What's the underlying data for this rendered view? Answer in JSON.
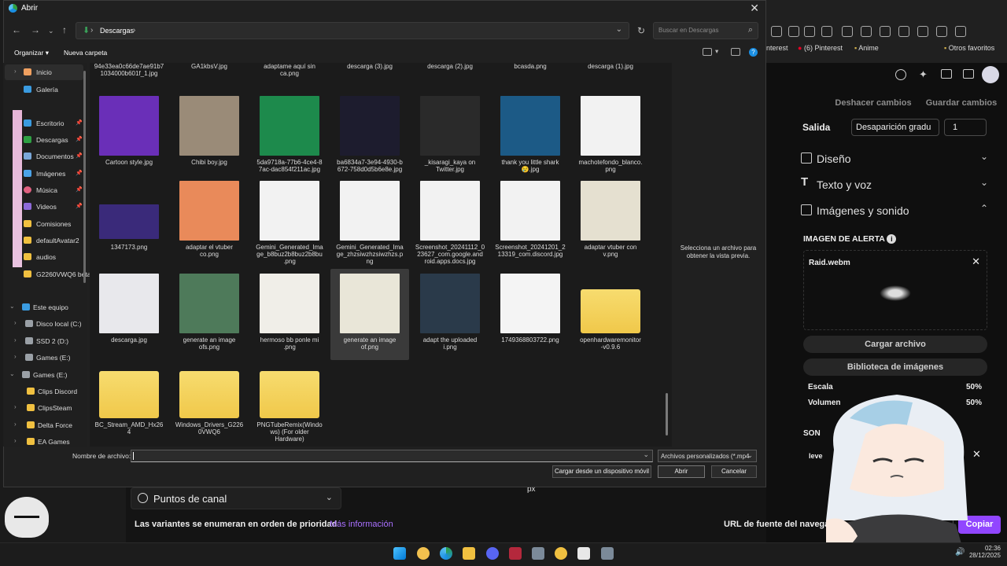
{
  "dialog": {
    "title": "Abrir",
    "breadcrumb": "Descargas",
    "search_placeholder": "Buscar en Descargas",
    "toolbar": {
      "organize": "Organizar",
      "new_folder": "Nueva carpeta"
    },
    "sidebar": {
      "items": [
        {
          "label": "Inicio"
        },
        {
          "label": "Galería"
        },
        {
          "label": "Escritorio"
        },
        {
          "label": "Descargas"
        },
        {
          "label": "Documentos"
        },
        {
          "label": "Imágenes"
        },
        {
          "label": "Música"
        },
        {
          "label": "Videos"
        },
        {
          "label": "Comisiones"
        },
        {
          "label": "defaultAvatar2"
        },
        {
          "label": "audios"
        },
        {
          "label": "G2260VWQ6 beta"
        },
        {
          "label": "Este equipo"
        },
        {
          "label": "Disco local (C:)"
        },
        {
          "label": "SSD 2 (D:)"
        },
        {
          "label": "Games  (E:)"
        },
        {
          "label": "Games  (E:)"
        },
        {
          "label": "Clips Discord"
        },
        {
          "label": "ClipsSteam"
        },
        {
          "label": "Delta Force"
        },
        {
          "label": "EA Games"
        }
      ]
    },
    "files": [
      {
        "l1": "94e33ea0c66de7ae91b7",
        "l2": "1034000b601f_1.jpg",
        "l3": ""
      },
      {
        "l1": "GA1kbsV.jpg",
        "l2": "",
        "l3": ""
      },
      {
        "l1": "adaptame aquí sin",
        "l2": "ca.png",
        "l3": ""
      },
      {
        "l1": "descarga (3).jpg",
        "l2": "",
        "l3": ""
      },
      {
        "l1": "descarga (2).jpg",
        "l2": "",
        "l3": ""
      },
      {
        "l1": "bcasda.png",
        "l2": "",
        "l3": ""
      },
      {
        "l1": "descarga (1).jpg",
        "l2": "",
        "l3": ""
      },
      {
        "l1": "Cartoon style.jpg",
        "l2": "",
        "l3": ""
      },
      {
        "l1": "Chibi boy.jpg",
        "l2": "",
        "l3": ""
      },
      {
        "l1": "5da9718a-77b6-4ce4-8",
        "l2": "7ac-dac854f211ac.jpg",
        "l3": ""
      },
      {
        "l1": "ba6834a7-3e94-4930-b",
        "l2": "672-758d0d5b6e8e.jpg",
        "l3": ""
      },
      {
        "l1": "_kisaragi_kaya on",
        "l2": "Twitter.jpg",
        "l3": ""
      },
      {
        "l1": "thank you little shark",
        "l2": "😢.jpg",
        "l3": ""
      },
      {
        "l1": "machotefondo_blanco.",
        "l2": "png",
        "l3": ""
      },
      {
        "l1": "1347173.png",
        "l2": "",
        "l3": ""
      },
      {
        "l1": "adaptar el vtuber",
        "l2": "co.png",
        "l3": ""
      },
      {
        "l1": "Gemini_Generated_Ima",
        "l2": "ge_b8buz2b8buz2b8bu",
        "l3": ".png"
      },
      {
        "l1": "Gemini_Generated_Ima",
        "l2": "ge_zhzsiwzhzsiwzhzs.p",
        "l3": "ng"
      },
      {
        "l1": "Screenshot_20241112_0",
        "l2": "23627_com.google.and",
        "l3": "roid.apps.docs.jpg"
      },
      {
        "l1": "Screenshot_20241201_2",
        "l2": "13319_com.discord.jpg",
        "l3": ""
      },
      {
        "l1": "adaptar vtuber con",
        "l2": "v.png",
        "l3": ""
      },
      {
        "l1": "descarga.jpg",
        "l2": "",
        "l3": ""
      },
      {
        "l1": "generate an image",
        "l2": "ofs.png",
        "l3": ""
      },
      {
        "l1": "hermoso bb ponle mi",
        "l2": ".png",
        "l3": ""
      },
      {
        "l1": "generate an image",
        "l2": "of.png",
        "l3": ""
      },
      {
        "l1": "adapt the uploaded",
        "l2": "i.png",
        "l3": ""
      },
      {
        "l1": "1749368803722.png",
        "l2": "",
        "l3": ""
      },
      {
        "l1": "openhardwaremonitor",
        "l2": "-v0.9.6",
        "l3": ""
      },
      {
        "l1": "BC_Stream_AMD_Hx26",
        "l2": "4",
        "l3": ""
      },
      {
        "l1": "Windows_Drivers_G226",
        "l2": "0VWQ6",
        "l3": ""
      },
      {
        "l1": "PNGTubeRemix(Windo",
        "l2": "ws) (For older",
        "l3": "Hardware)"
      }
    ],
    "preview_message": "Selecciona un archivo para obtener la vista previa.",
    "filename_label": "Nombre de archivo:",
    "filename_value": "",
    "file_type": "Archivos personalizados (*.mp4",
    "buttons": {
      "device": "Cargar desde un dispositivo móvil",
      "open": "Abrir",
      "cancel": "Cancelar"
    }
  },
  "browser": {
    "bookmarks": [
      "nterest",
      "(6) Pinterest",
      "Anime",
      "Otros favoritos"
    ]
  },
  "panel": {
    "undo": "Deshacer cambios",
    "save": "Guardar cambios",
    "salida_label": "Salida",
    "salida_value": "Desaparición gradu",
    "salida_number": "1",
    "sections": {
      "design": "Diseño",
      "text_voice": "Texto y voz",
      "images_sound": "Imágenes y sonido"
    },
    "alert_image_label": "IMAGEN DE ALERTA",
    "alert_file": "Raid.webm",
    "load_file": "Cargar archivo",
    "library": "Biblioteca de imágenes",
    "scale_label": "Escala",
    "scale_value": "50%",
    "volume_label": "Volumen",
    "volume_value": "50%",
    "sound_label": "SON",
    "sound_file": "leve",
    "copy": "Copiar",
    "font_url_label": "URL de fuente del navegad"
  },
  "page": {
    "points_title": "Puntos de canal",
    "variants_text": "Las variantes se enumeran en orden de prioridad",
    "more_info": "Más información",
    "px_text": "px"
  },
  "taskbar": {
    "time": "02:36",
    "date": "28/12/2025"
  },
  "colors": {
    "accent": "#9146ff",
    "dialog_bg": "#202020",
    "folder": "#f6d55a"
  }
}
